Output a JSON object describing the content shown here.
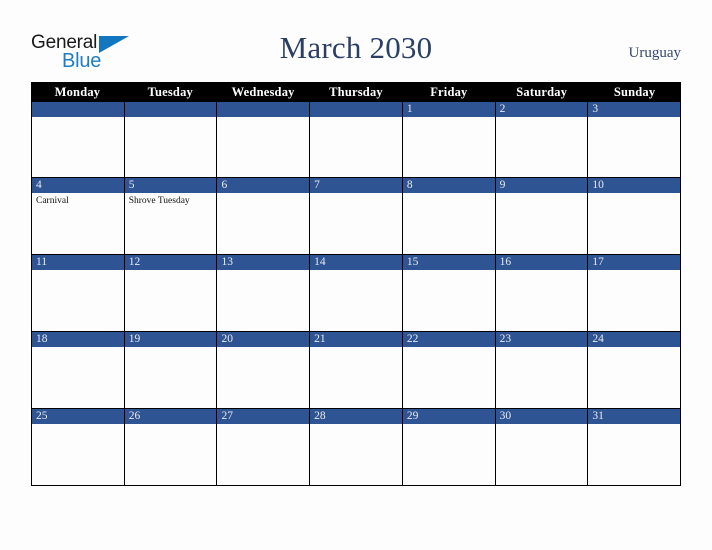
{
  "brand": {
    "name_line1": "General",
    "name_line2": "Blue",
    "triangle_icon": "triangle-icon",
    "line1_color": "#1a1a1a",
    "line2_color": "#1f7dc4",
    "triangle_color": "#1277bf"
  },
  "header": {
    "title": "March 2030",
    "country": "Uruguay",
    "title_color": "#2b3f63",
    "country_color": "#36476a"
  },
  "calendar": {
    "header_bg": "#000000",
    "header_text_color": "#ffffff",
    "date_bar_bg": "#2f5494",
    "date_bar_text_color": "#e8eaef",
    "cell_bg": "#fdfdfd",
    "border_color": "#000000",
    "weekdays": [
      "Monday",
      "Tuesday",
      "Wednesday",
      "Thursday",
      "Friday",
      "Saturday",
      "Sunday"
    ],
    "weeks": [
      [
        {
          "date": "",
          "events": []
        },
        {
          "date": "",
          "events": []
        },
        {
          "date": "",
          "events": []
        },
        {
          "date": "",
          "events": []
        },
        {
          "date": "1",
          "events": []
        },
        {
          "date": "2",
          "events": []
        },
        {
          "date": "3",
          "events": []
        }
      ],
      [
        {
          "date": "4",
          "events": [
            "Carnival"
          ]
        },
        {
          "date": "5",
          "events": [
            "Shrove Tuesday"
          ]
        },
        {
          "date": "6",
          "events": []
        },
        {
          "date": "7",
          "events": []
        },
        {
          "date": "8",
          "events": []
        },
        {
          "date": "9",
          "events": []
        },
        {
          "date": "10",
          "events": []
        }
      ],
      [
        {
          "date": "11",
          "events": []
        },
        {
          "date": "12",
          "events": []
        },
        {
          "date": "13",
          "events": []
        },
        {
          "date": "14",
          "events": []
        },
        {
          "date": "15",
          "events": []
        },
        {
          "date": "16",
          "events": []
        },
        {
          "date": "17",
          "events": []
        }
      ],
      [
        {
          "date": "18",
          "events": []
        },
        {
          "date": "19",
          "events": []
        },
        {
          "date": "20",
          "events": []
        },
        {
          "date": "21",
          "events": []
        },
        {
          "date": "22",
          "events": []
        },
        {
          "date": "23",
          "events": []
        },
        {
          "date": "24",
          "events": []
        }
      ],
      [
        {
          "date": "25",
          "events": []
        },
        {
          "date": "26",
          "events": []
        },
        {
          "date": "27",
          "events": []
        },
        {
          "date": "28",
          "events": []
        },
        {
          "date": "29",
          "events": []
        },
        {
          "date": "30",
          "events": []
        },
        {
          "date": "31",
          "events": []
        }
      ]
    ]
  }
}
